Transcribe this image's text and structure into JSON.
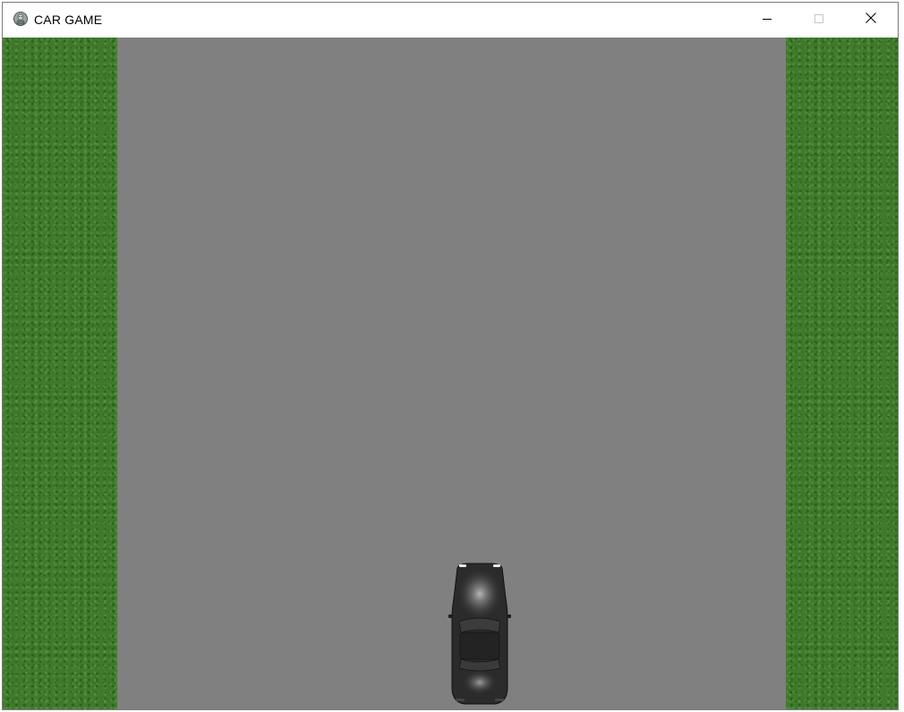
{
  "window": {
    "title": "CAR GAME",
    "app_icon": "pygame-icon",
    "buttons": {
      "minimize": "minimize-icon",
      "maximize": "maximize-icon",
      "close": "close-icon"
    }
  },
  "game": {
    "road_color": "#808080",
    "grass_color": "#3f7a2c",
    "player_car": {
      "color": "#2a2a2a"
    }
  }
}
